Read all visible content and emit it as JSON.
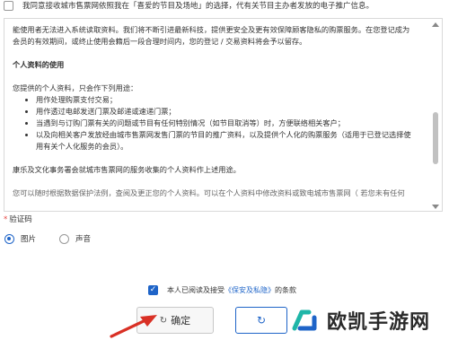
{
  "consent": {
    "text": "我同意接收城市售票网依照我在「喜爱的节目及场地」的选择，代有关节目主办者发放的电子推广信息。"
  },
  "policy": {
    "intro_lines": [
      "能使用者无法进入系统读取资料。我们将不断引进最新科技，提供更安全及更有效保障顾客隐私的购票服务。在您登记成为",
      "会员的有效期间，或终止使用会籍后一段合理时间内，您的登记 / 交易资料将会予以留存。"
    ],
    "section_title": "个人资料的使用",
    "usage_intro": "您提供的个人资料，只会作下列用途：",
    "bullets": [
      "用作处理购票支付交易；",
      "用作透过电邮发送门票及邮递或速递门票；",
      "当遇到与订购门票有关的问题或节目有任何特别情况（如节目取消等）时，方便联络相关客户；",
      "以及向相关客户发放经由城市售票网发售门票的节目的推广资料，以及提供个人化的购票服务（适用于已登记选择使",
      "用有关个人化服务的会员）。"
    ],
    "closing": "康乐及文化事务署会就城市售票网的服务收集的个人资料作上述用途。",
    "cutoff": "您可以随时根据数据保护法例，查阅及更正您的个人资料。可以在个人资料中修改资料或致电城市售票网（ 若您未有任何"
  },
  "captcha": {
    "required_mark": "*",
    "label": "验证码",
    "options": [
      {
        "label": "图片",
        "selected": true
      },
      {
        "label": "声音",
        "selected": false
      }
    ]
  },
  "agreement": {
    "text_before": "本人已阅读及接受",
    "link": "《保安及私隐》",
    "text_after": "的条款",
    "checked": true
  },
  "buttons": {
    "confirm_icon": "↻",
    "confirm": "确定",
    "refresh_icon": "↻"
  },
  "watermark": {
    "text": "欧凯手游网"
  },
  "colors": {
    "accent": "#1e64c8",
    "required": "#e64340",
    "arrow": "#d93025"
  }
}
